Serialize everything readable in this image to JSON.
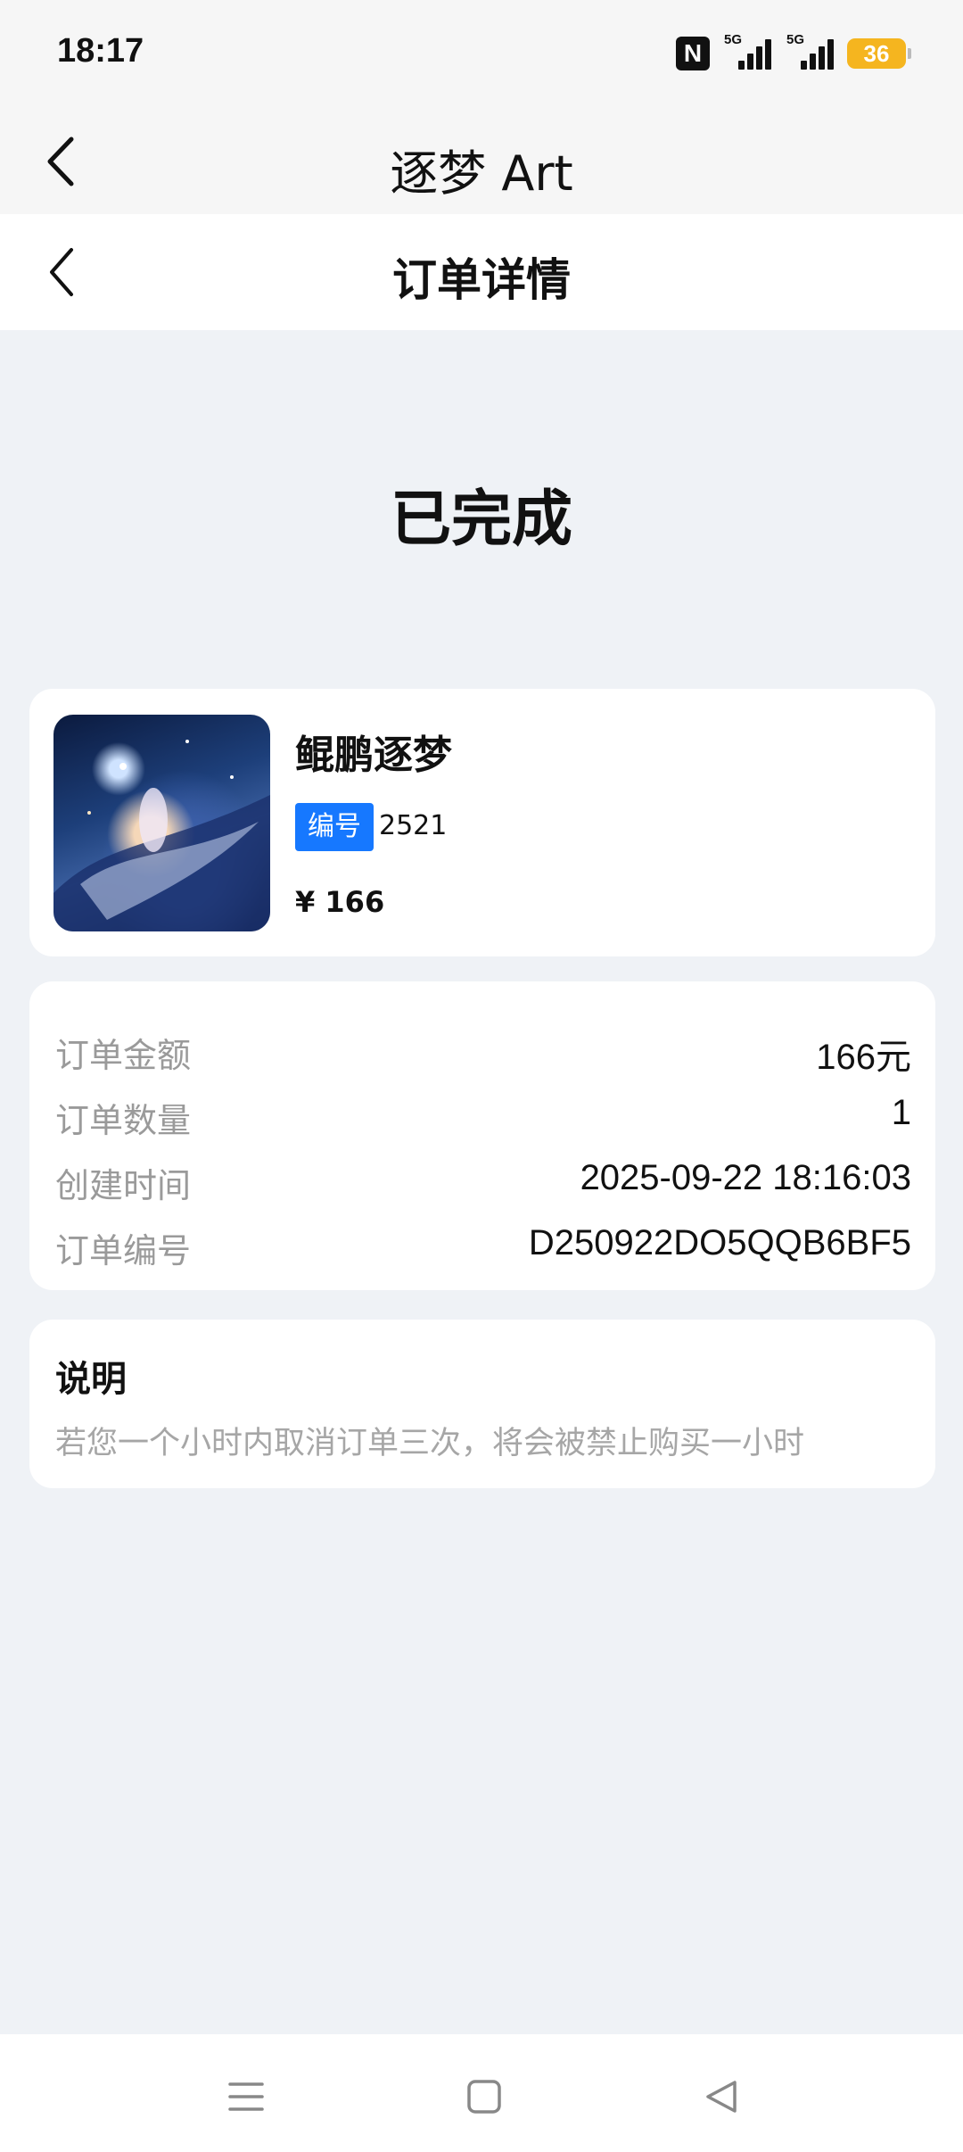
{
  "status_bar": {
    "time": "18:17",
    "nfc_label": "N",
    "signal1_label": "5G",
    "signal2_label": "5G",
    "battery_level": "36"
  },
  "app_bar": {
    "title": "逐梦 Art",
    "back_icon": "chevron-left-icon"
  },
  "page_header": {
    "title": "订单详情",
    "back_icon": "chevron-left-icon"
  },
  "order": {
    "status": "已完成"
  },
  "product": {
    "name": "鲲鹏逐梦",
    "code_label": "编号",
    "code_value": "2521",
    "price": "¥ 166"
  },
  "info": {
    "rows": [
      {
        "label": "订单金额",
        "value": "166元"
      },
      {
        "label": "订单数量",
        "value": "1"
      },
      {
        "label": "创建时间",
        "value": "2025-09-22 18:16:03"
      },
      {
        "label": "订单编号",
        "value": "D250922DO5QQB6BF5"
      }
    ]
  },
  "note": {
    "title": "说明",
    "text": "若您一个小时内取消订单三次，将会被禁止购买一小时"
  },
  "nav_bar": {
    "icons": [
      "menu-icon",
      "home-square-icon",
      "back-triangle-icon"
    ]
  },
  "colors": {
    "accent": "#1678ff",
    "battery": "#f5b51f",
    "page_bg": "#eff2f6"
  }
}
